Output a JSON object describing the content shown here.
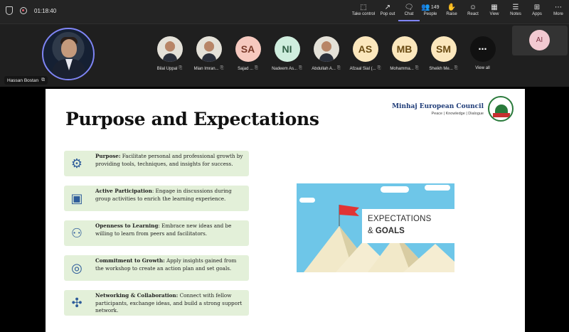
{
  "topbar": {
    "timer": "01:18:40",
    "buttons": [
      {
        "label": "Take control",
        "icon": "take-control-icon",
        "glyph": "⬚"
      },
      {
        "label": "Pop out",
        "icon": "pop-out-icon",
        "glyph": "↗"
      },
      {
        "label": "Chat",
        "icon": "chat-icon",
        "glyph": "🗨"
      },
      {
        "label": "People",
        "icon": "people-icon",
        "glyph": "👥",
        "count": "149"
      },
      {
        "label": "Raise",
        "icon": "raise-hand-icon",
        "glyph": "✋"
      },
      {
        "label": "React",
        "icon": "react-icon",
        "glyph": "☺"
      },
      {
        "label": "View",
        "icon": "view-icon",
        "glyph": "▦"
      },
      {
        "label": "Notes",
        "icon": "notes-icon",
        "glyph": "☰"
      },
      {
        "label": "Apps",
        "icon": "apps-icon",
        "glyph": "⊞"
      },
      {
        "label": "More",
        "icon": "more-icon",
        "glyph": "⋯"
      }
    ]
  },
  "self": {
    "name": "Hassan Bostan"
  },
  "participants": [
    {
      "name": "Bilal Uppal",
      "initials": "",
      "photo": true,
      "bg": "#e3e0d6"
    },
    {
      "name": "Mian Imran...",
      "initials": "",
      "photo": true,
      "bg": "#e3e0d6"
    },
    {
      "name": "Sajad ...",
      "initials": "SA",
      "photo": false,
      "bg": "#f6c9bf",
      "fg": "#7a3a2a"
    },
    {
      "name": "Nadeem As...",
      "initials": "NI",
      "photo": false,
      "bg": "#cfeede",
      "fg": "#2f5f45"
    },
    {
      "name": "Abdullah A...",
      "initials": "",
      "photo": true,
      "bg": "#e3e0d6"
    },
    {
      "name": "Afzaal Sial (...",
      "initials": "AS",
      "photo": false,
      "bg": "#fbe7bd",
      "fg": "#6a4b12"
    },
    {
      "name": "Mohamma...",
      "initials": "MB",
      "photo": false,
      "bg": "#fbe7bd",
      "fg": "#6a4b12"
    },
    {
      "name": "Sheikh Me...",
      "initials": "SM",
      "photo": false,
      "bg": "#fbe7bd",
      "fg": "#6a4b12"
    }
  ],
  "view_all": {
    "label": "View all",
    "glyph": "⋯"
  },
  "ai_tile": {
    "initials": "AI"
  },
  "slide": {
    "title": "Purpose and Expectations",
    "org_name": "Minhaj European Council",
    "org_tagline": "Peace | Knowledge | Dialogue",
    "items": [
      {
        "heading": "Purpose:",
        "text": " Facilitate personal and professional growth by providing tools, techniques, and insights for success.",
        "icon": "head-gear-icon",
        "glyph": "⚙"
      },
      {
        "heading": "Active Participation",
        "text": ": Engage in discussions during group activities to enrich the learning experience.",
        "icon": "presentation-icon",
        "glyph": "▣"
      },
      {
        "heading": "Openness to Learning",
        "text": ": Embrace new ideas and be willing to learn from peers and facilitators.",
        "icon": "group-icon",
        "glyph": "⚇"
      },
      {
        "heading": "Commitment to Growth:",
        "text": " Apply insights gained from the workshop to create an action plan and set goals.",
        "icon": "target-icon",
        "glyph": "◎"
      },
      {
        "heading": "Networking & Collaboration:",
        "text": " Connect with fellow participants, exchange ideas, and build a strong support network.",
        "icon": "network-icon",
        "glyph": "✣"
      }
    ],
    "image": {
      "line1": "EXPECTATIONS",
      "line2_prefix": "& ",
      "line2_bold": "GOALS"
    }
  }
}
